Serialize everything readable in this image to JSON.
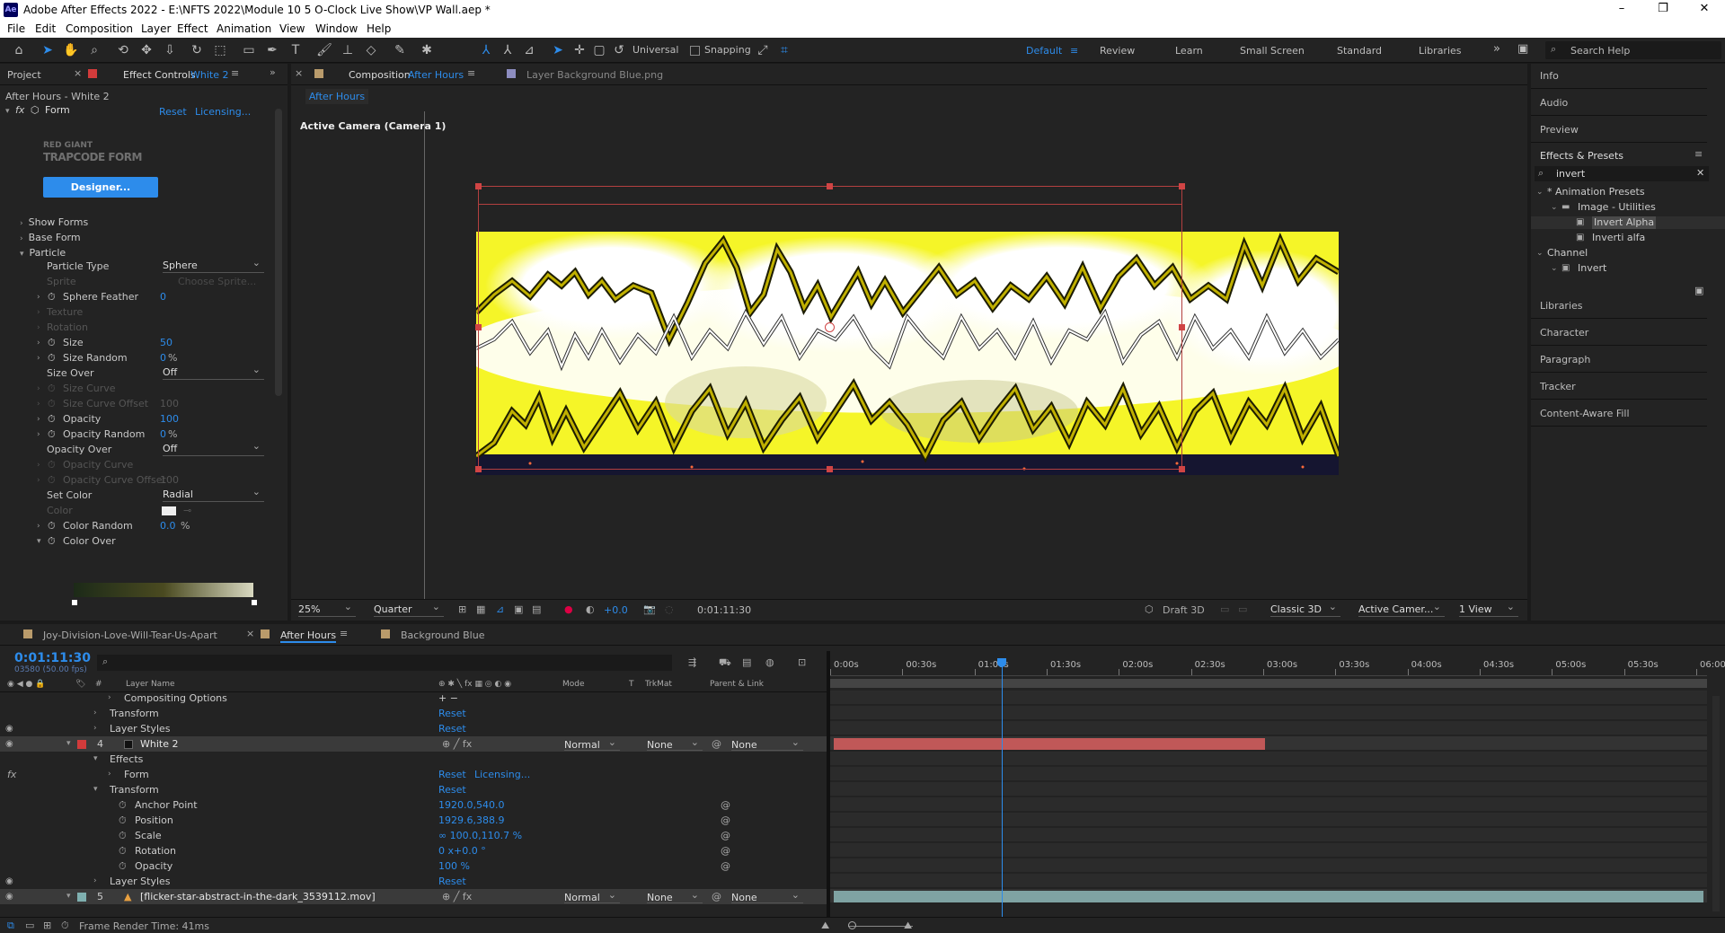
{
  "window": {
    "title": "Adobe After Effects 2022 - E:\\NFTS 2022\\Module 10 5 O-Clock Live Show\\VP Wall.aep *",
    "logo": "Ae",
    "min": "–",
    "max": "❐",
    "close": "✕"
  },
  "menu": [
    "File",
    "Edit",
    "Composition",
    "Layer",
    "Effect",
    "Animation",
    "View",
    "Window",
    "Help"
  ],
  "toolbar": {
    "universal": "Universal",
    "snapping": "Snapping"
  },
  "workspaces": [
    "Default",
    "Review",
    "Learn",
    "Small Screen",
    "Standard",
    "Libraries"
  ],
  "search_help": "Search Help",
  "left": {
    "tab_project": "Project",
    "tab_effect_prefix": "Effect Controls",
    "tab_effect_layer": "White 2",
    "crumb": "After Hours - White 2",
    "effect": "Form",
    "reset": "Reset",
    "licensing": "Licensing...",
    "brand1": "RED GIANT",
    "brand2": "TRAPCODE FORM",
    "designer": "Designer...",
    "groups": [
      "Show Forms",
      "Base Form",
      "Particle"
    ],
    "props": [
      {
        "label": "Particle Type",
        "dd": "Sphere",
        "active": true,
        "kind": "dd"
      },
      {
        "label": "Sprite",
        "val": "Choose Sprite...",
        "active": false,
        "kind": "txt"
      },
      {
        "label": "Sphere Feather",
        "val": "0",
        "active": true,
        "kind": "num",
        "sw": true,
        "tw": true
      },
      {
        "label": "Texture",
        "active": false,
        "kind": "none",
        "tw": true
      },
      {
        "label": "Rotation",
        "active": false,
        "kind": "none",
        "tw": true
      },
      {
        "label": "Size",
        "val": "50",
        "active": true,
        "kind": "num",
        "sw": true,
        "tw": true
      },
      {
        "label": "Size Random",
        "val": "0",
        "unit": "%",
        "active": true,
        "kind": "num",
        "sw": true,
        "tw": true
      },
      {
        "label": "Size Over",
        "dd": "Off",
        "active": true,
        "kind": "dd"
      },
      {
        "label": "Size Curve",
        "active": false,
        "kind": "none",
        "sw": true,
        "tw": true
      },
      {
        "label": "Size Curve Offset",
        "val": "100",
        "active": false,
        "kind": "num",
        "sw": true,
        "tw": true
      },
      {
        "label": "Opacity",
        "val": "100",
        "active": true,
        "kind": "num",
        "sw": true,
        "tw": true
      },
      {
        "label": "Opacity Random",
        "val": "0",
        "unit": "%",
        "active": true,
        "kind": "num",
        "sw": true,
        "tw": true
      },
      {
        "label": "Opacity Over",
        "dd": "Off",
        "active": true,
        "kind": "dd"
      },
      {
        "label": "Opacity Curve",
        "active": false,
        "kind": "none",
        "sw": true,
        "tw": true
      },
      {
        "label": "Opacity Curve Offset",
        "val": "100",
        "active": false,
        "kind": "num",
        "sw": true,
        "tw": true
      },
      {
        "label": "Set Color",
        "dd": "Radial",
        "active": true,
        "kind": "dd"
      },
      {
        "label": "Color",
        "active": false,
        "kind": "color"
      },
      {
        "label": "Color Random",
        "val": "0.0",
        "unit": "%",
        "active": true,
        "kind": "num",
        "sw": true,
        "tw": true
      },
      {
        "label": "Color Over",
        "active": true,
        "kind": "none",
        "sw": true,
        "tw": true,
        "open": true
      }
    ]
  },
  "comp": {
    "tab_prefix": "Composition",
    "tab_name": "After Hours",
    "tab_layer": "Layer  Background Blue.png",
    "subtab": "After Hours",
    "camera": "Active Camera (Camera 1)",
    "footer": {
      "zoom": "25%",
      "quality": "Quarter",
      "exposure": "+0.0",
      "time": "0:01:11:30",
      "draft": "Draft 3D",
      "renderer": "Classic 3D",
      "camera": "Active Camer...",
      "views": "1 View"
    }
  },
  "right": {
    "items1": [
      "Info",
      "Audio",
      "Preview"
    ],
    "effects_title": "Effects & Presets",
    "search": "invert",
    "tree": [
      {
        "label": "* Animation Presets",
        "level": 0,
        "sel": false
      },
      {
        "label": "Image - Utilities",
        "level": 1,
        "sel": false
      },
      {
        "label": "Invert Alpha",
        "level": 2,
        "sel": true
      },
      {
        "label": "Inverti alfa",
        "level": 2,
        "sel": false
      },
      {
        "label": "Channel",
        "level": 0,
        "sel": false
      },
      {
        "label": "Invert",
        "level": 1,
        "sel": false
      }
    ],
    "items2": [
      "Libraries",
      "Character",
      "Paragraph",
      "Tracker",
      "Content-Aware Fill"
    ]
  },
  "timeline": {
    "tabs": [
      "Joy-Division-Love-Will-Tear-Us-Apart",
      "After Hours",
      "Background Blue"
    ],
    "time": "0:01:11:30",
    "frames": "03580 (50.00 fps)",
    "headers": {
      "layer_name": "Layer Name",
      "mode": "Mode",
      "t": "T",
      "trkmat": "TrkMat",
      "parent": "Parent & Link"
    },
    "ruler": [
      "0:00s",
      "00:30s",
      "01:00s",
      "01:30s",
      "02:00s",
      "02:30s",
      "03:00s",
      "03:30s",
      "04:00s",
      "04:30s",
      "05:00s",
      "05:30s",
      "06:00"
    ],
    "playhead_frac": 0.196,
    "rows": [
      {
        "indent": 2,
        "label": "Compositing Options",
        "val": "+ −",
        "eye": false,
        "kind": "prop"
      },
      {
        "indent": 1,
        "label": "Transform",
        "val": "Reset",
        "eye": false,
        "kind": "prop"
      },
      {
        "indent": 1,
        "label": "Layer Styles",
        "val": "Reset",
        "eye": true,
        "kind": "prop"
      },
      {
        "indent": 0,
        "num": "4",
        "label": "White 2",
        "eye": true,
        "kind": "layer",
        "mode": "Normal",
        "trk": "None",
        "parent": "None",
        "color": "#d23b3b",
        "bar": [
          0.0,
          0.5
        ]
      },
      {
        "indent": 1,
        "label": "Effects",
        "eye": false,
        "kind": "prop"
      },
      {
        "indent": 2,
        "label": "Form",
        "val": "Reset",
        "val2": "Licensing...",
        "fx": true,
        "eye": false,
        "kind": "prop"
      },
      {
        "indent": 1,
        "label": "Transform",
        "val": "Reset",
        "eye": false,
        "kind": "prop"
      },
      {
        "indent": 2,
        "label": "Anchor Point",
        "val": "1920.0,540.0",
        "sw": true,
        "link": true,
        "eye": false,
        "kind": "prop"
      },
      {
        "indent": 2,
        "label": "Position",
        "val": "1929.6,388.9",
        "sw": true,
        "link": true,
        "eye": false,
        "kind": "prop"
      },
      {
        "indent": 2,
        "label": "Scale",
        "val": "∞ 100.0,110.7 %",
        "sw": true,
        "link": true,
        "eye": false,
        "kind": "prop"
      },
      {
        "indent": 2,
        "label": "Rotation",
        "val": "0 x+0.0 °",
        "sw": true,
        "link": true,
        "eye": false,
        "kind": "prop"
      },
      {
        "indent": 2,
        "label": "Opacity",
        "val": "100 %",
        "sw": true,
        "link": true,
        "eye": false,
        "kind": "prop"
      },
      {
        "indent": 1,
        "label": "Layer Styles",
        "val": "Reset",
        "eye": true,
        "kind": "prop"
      },
      {
        "indent": 0,
        "num": "5",
        "label": "[flicker-star-abstract-in-the-dark_3539112.mov]",
        "eye": true,
        "kind": "layer",
        "mode": "Normal",
        "trk": "None",
        "parent": "None",
        "color": "#7fb0b0",
        "bar": [
          0.0,
          1.0
        ],
        "warn": true
      }
    ],
    "status": "Frame Render Time: 41ms"
  }
}
